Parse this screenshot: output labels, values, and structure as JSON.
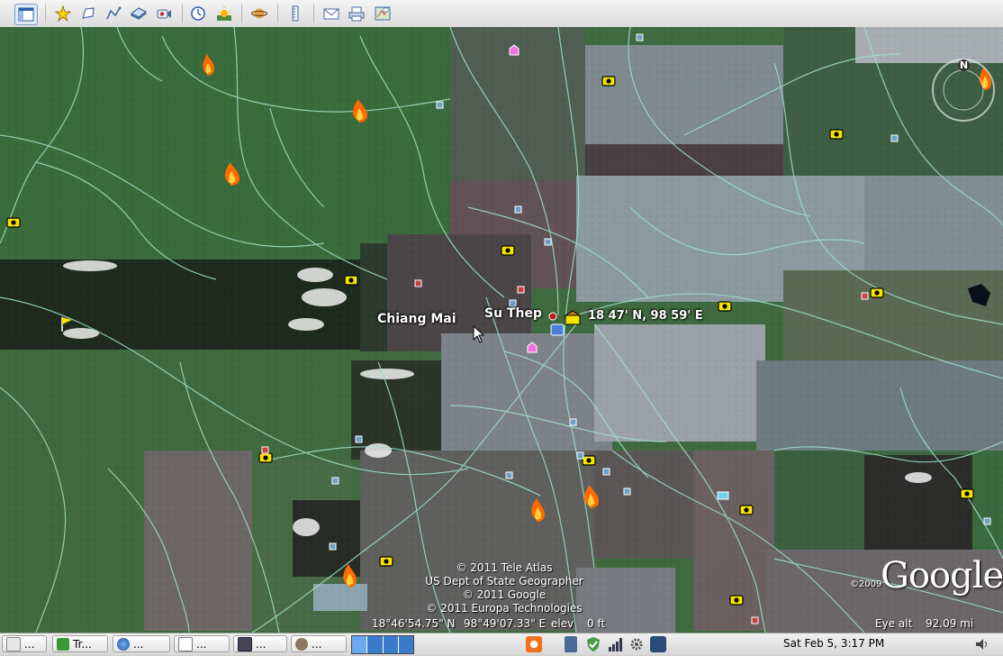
{
  "toolbar": {
    "buttons": [
      {
        "name": "sidebar-toggle-button",
        "icon": "sidebar-icon"
      },
      {
        "name": "add-placemark-button",
        "icon": "placemark-icon"
      },
      {
        "name": "add-polygon-button",
        "icon": "polygon-icon"
      },
      {
        "name": "add-path-button",
        "icon": "path-icon"
      },
      {
        "name": "add-image-overlay-button",
        "icon": "image-overlay-icon"
      },
      {
        "name": "record-tour-button",
        "icon": "record-tour-icon"
      },
      {
        "name": "historical-imagery-button",
        "icon": "clock-icon"
      },
      {
        "name": "sunlight-button",
        "icon": "sun-icon"
      },
      {
        "name": "switch-to-sky-button",
        "icon": "planet-icon"
      },
      {
        "name": "ruler-button",
        "icon": "ruler-icon"
      },
      {
        "name": "email-button",
        "icon": "email-icon"
      },
      {
        "name": "print-button",
        "icon": "print-icon"
      },
      {
        "name": "view-in-maps-button",
        "icon": "map-icon"
      }
    ]
  },
  "map": {
    "labels": {
      "chiang_mai": "Chiang Mai",
      "su_thep": "Su Thep",
      "coords": "18 47' N, 98 59' E"
    },
    "attribution": [
      "© 2011 Tele Atlas",
      "US Dept of State Geographer",
      "© 2011 Google",
      "© 2011 Europa Technologies"
    ],
    "logo": "Google",
    "logo_year": "©2009",
    "compass_north": "N",
    "status": {
      "lat": "18°46'54.75\" N",
      "lon": "98°49'07.33\" E",
      "elev_label": "elev",
      "elev_value": "0 ft",
      "eye_alt": "Eye alt",
      "eye_alt_value": "92.09 mi"
    }
  },
  "taskbar": {
    "items": [
      {
        "label": "...",
        "name": "taskbar-item-1"
      },
      {
        "label": "Tr...",
        "name": "taskbar-item-terminal"
      },
      {
        "label": "...",
        "name": "taskbar-item-earth"
      },
      {
        "label": "...",
        "name": "taskbar-item-doc"
      },
      {
        "label": "...",
        "name": "taskbar-item-window"
      },
      {
        "label": "...",
        "name": "taskbar-item-gimp"
      }
    ],
    "clock": "Sat Feb  5,  3:17 PM"
  },
  "colors": {
    "roads": "#9fe0c8",
    "fire": "#ff6a00",
    "camera": "#f5e400"
  }
}
